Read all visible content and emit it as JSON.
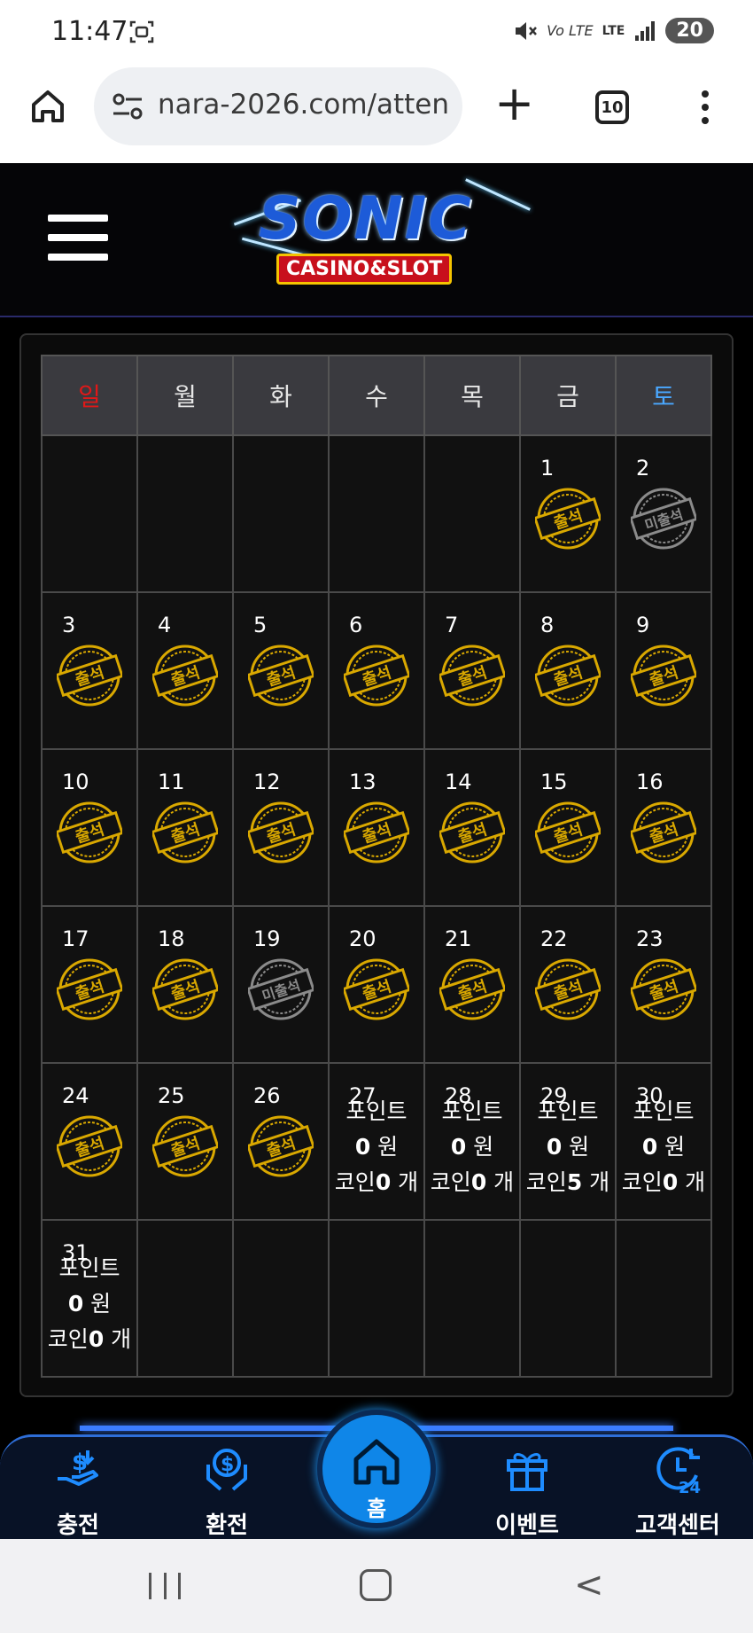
{
  "status_bar": {
    "time": "11:47",
    "network": "LTE",
    "volte": "Vo LTE",
    "battery": "20"
  },
  "browser": {
    "url": "nara-2026.com/atten",
    "tab_count": "10"
  },
  "site": {
    "logo_title": "SONIC",
    "logo_subtitle": "CASINO&SLOT"
  },
  "calendar": {
    "weekdays": [
      "일",
      "월",
      "화",
      "수",
      "목",
      "금",
      "토"
    ],
    "stamp_attended": "출석",
    "stamp_absent": "미출석",
    "weeks": [
      [
        {
          "day": "",
          "status": "empty"
        },
        {
          "day": "",
          "status": "empty"
        },
        {
          "day": "",
          "status": "empty"
        },
        {
          "day": "",
          "status": "empty"
        },
        {
          "day": "",
          "status": "empty"
        },
        {
          "day": "1",
          "status": "attended"
        },
        {
          "day": "2",
          "status": "absent"
        }
      ],
      [
        {
          "day": "3",
          "status": "attended"
        },
        {
          "day": "4",
          "status": "attended"
        },
        {
          "day": "5",
          "status": "attended"
        },
        {
          "day": "6",
          "status": "attended"
        },
        {
          "day": "7",
          "status": "attended"
        },
        {
          "day": "8",
          "status": "attended"
        },
        {
          "day": "9",
          "status": "attended"
        }
      ],
      [
        {
          "day": "10",
          "status": "attended"
        },
        {
          "day": "11",
          "status": "attended"
        },
        {
          "day": "12",
          "status": "attended"
        },
        {
          "day": "13",
          "status": "attended"
        },
        {
          "day": "14",
          "status": "attended"
        },
        {
          "day": "15",
          "status": "attended"
        },
        {
          "day": "16",
          "status": "attended"
        }
      ],
      [
        {
          "day": "17",
          "status": "attended"
        },
        {
          "day": "18",
          "status": "attended"
        },
        {
          "day": "19",
          "status": "absent"
        },
        {
          "day": "20",
          "status": "attended"
        },
        {
          "day": "21",
          "status": "attended"
        },
        {
          "day": "22",
          "status": "attended"
        },
        {
          "day": "23",
          "status": "attended"
        }
      ],
      [
        {
          "day": "24",
          "status": "attended"
        },
        {
          "day": "25",
          "status": "attended"
        },
        {
          "day": "26",
          "status": "attended"
        },
        {
          "day": "27",
          "status": "info",
          "point_label": "포인트",
          "points": "0",
          "won": "원",
          "coin_label": "코인",
          "coins": "0",
          "unit": "개"
        },
        {
          "day": "28",
          "status": "info",
          "point_label": "포인트",
          "points": "0",
          "won": "원",
          "coin_label": "코인",
          "coins": "0",
          "unit": "개"
        },
        {
          "day": "29",
          "status": "info",
          "point_label": "포인트",
          "points": "0",
          "won": "원",
          "coin_label": "코인",
          "coins": "5",
          "unit": "개"
        },
        {
          "day": "30",
          "status": "info",
          "point_label": "포인트",
          "points": "0",
          "won": "원",
          "coin_label": "코인",
          "coins": "0",
          "unit": "개"
        }
      ],
      [
        {
          "day": "31",
          "status": "info",
          "point_label": "포인트",
          "points": "0",
          "won": "원",
          "coin_label": "코인",
          "coins": "0",
          "unit": "개"
        },
        {
          "day": "",
          "status": "empty"
        },
        {
          "day": "",
          "status": "empty"
        },
        {
          "day": "",
          "status": "empty"
        },
        {
          "day": "",
          "status": "empty"
        },
        {
          "day": "",
          "status": "empty"
        },
        {
          "day": "",
          "status": "empty"
        }
      ]
    ]
  },
  "bottom_nav": {
    "deposit": "충전",
    "withdraw": "환전",
    "home": "홈",
    "event": "이벤트",
    "support": "고객센터"
  },
  "colors": {
    "sunday": "#e01818",
    "saturday": "#4aa8ff",
    "stamp_gold": "#d9a800",
    "stamp_gray": "#8a8a8a",
    "nav_icon": "#1e8cff"
  }
}
